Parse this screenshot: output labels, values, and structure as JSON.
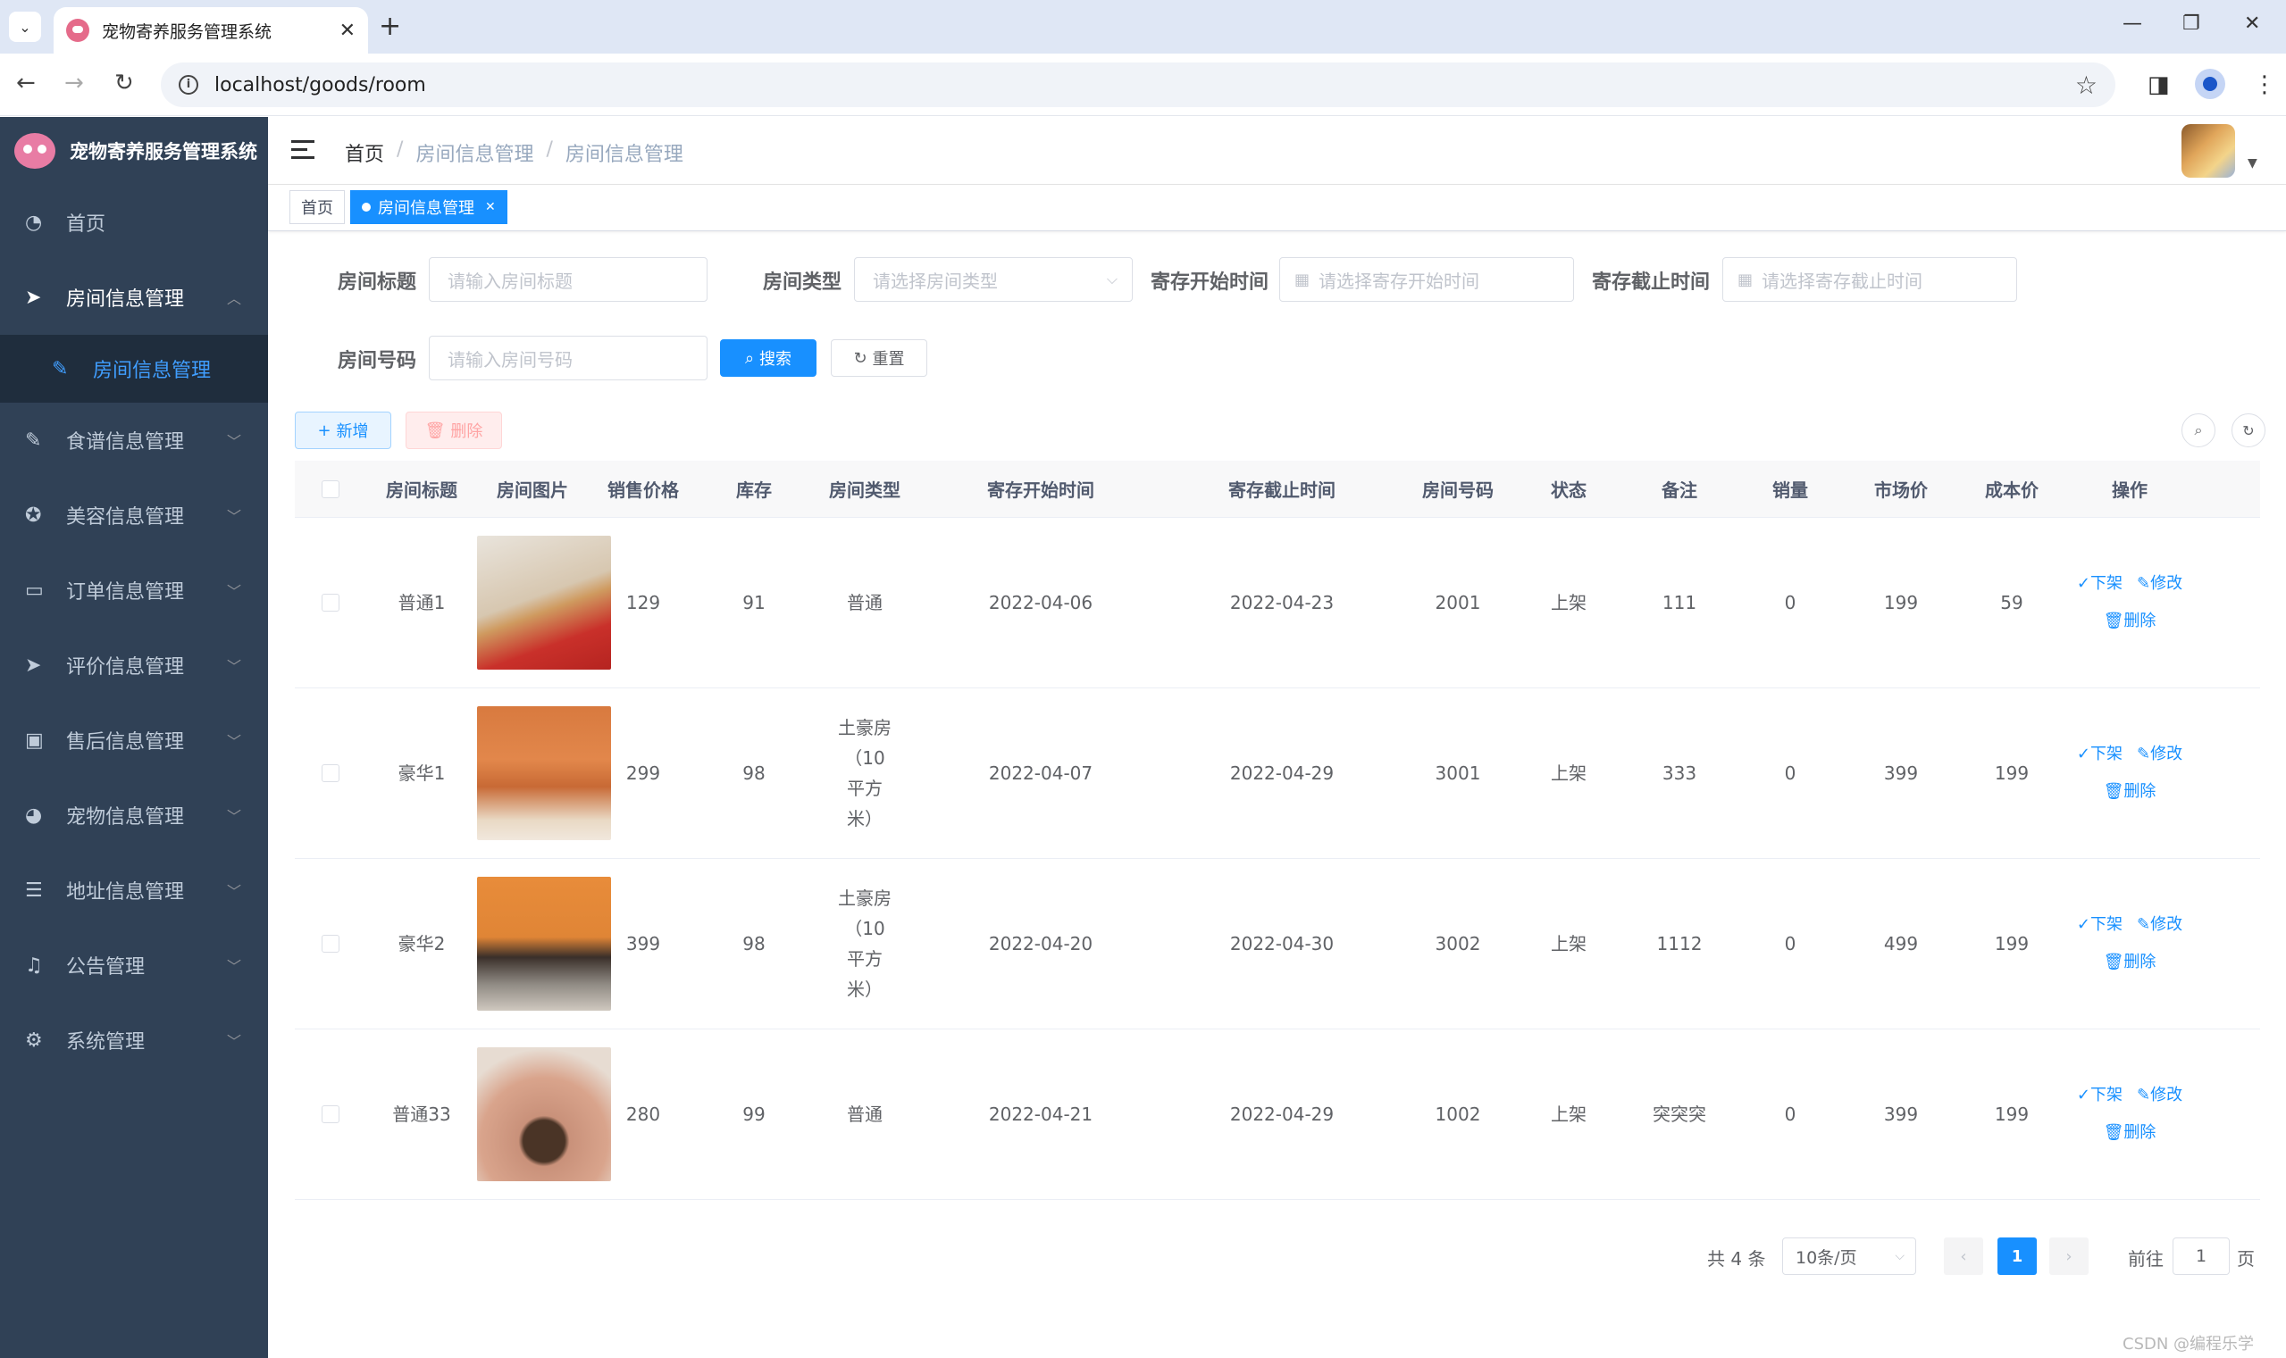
{
  "browser": {
    "tab_title": "宠物寄养服务管理系统",
    "url": "localhost/goods/room"
  },
  "sidebar": {
    "brand": "宠物寄养服务管理系统",
    "items": [
      {
        "label": "首页",
        "icon": "dashboard-icon"
      },
      {
        "label": "房间信息管理",
        "icon": "send-icon"
      },
      {
        "label": "食谱信息管理",
        "icon": "edit-icon"
      },
      {
        "label": "美容信息管理",
        "icon": "component-icon"
      },
      {
        "label": "订单信息管理",
        "icon": "monitor-icon"
      },
      {
        "label": "评价信息管理",
        "icon": "send-icon"
      },
      {
        "label": "售后信息管理",
        "icon": "shopping-icon"
      },
      {
        "label": "宠物信息管理",
        "icon": "globe-icon"
      },
      {
        "label": "地址信息管理",
        "icon": "sliders-icon"
      },
      {
        "label": "公告管理",
        "icon": "bell-icon"
      },
      {
        "label": "系统管理",
        "icon": "gear-icon"
      }
    ],
    "sub_item": "房间信息管理"
  },
  "navbar": {
    "breadcrumb": [
      "首页",
      "房间信息管理",
      "房间信息管理"
    ],
    "separator": "/"
  },
  "tags": {
    "home": "首页",
    "active": "房间信息管理"
  },
  "filters": {
    "title_label": "房间标题",
    "title_placeholder": "请输入房间标题",
    "type_label": "房间类型",
    "type_placeholder": "请选择房间类型",
    "start_label": "寄存开始时间",
    "start_placeholder": "请选择寄存开始时间",
    "end_label": "寄存截止时间",
    "end_placeholder": "请选择寄存截止时间",
    "number_label": "房间号码",
    "number_placeholder": "请输入房间号码",
    "search_btn": "搜索",
    "reset_btn": "重置"
  },
  "toolbar": {
    "add_btn": "新增",
    "delete_btn": "删除"
  },
  "table": {
    "headers": [
      "房间标题",
      "房间图片",
      "销售价格",
      "库存",
      "房间类型",
      "寄存开始时间",
      "寄存截止时间",
      "房间号码",
      "状态",
      "备注",
      "销量",
      "市场价",
      "成本价",
      "操作"
    ],
    "rows": [
      {
        "title": "普通1",
        "price": "129",
        "stock": "91",
        "type": "普通",
        "start": "2022-04-06",
        "end": "2022-04-23",
        "number": "2001",
        "status": "上架",
        "remark": "111",
        "sales": "0",
        "market": "199",
        "cost": "59"
      },
      {
        "title": "豪华1",
        "price": "299",
        "stock": "98",
        "type": "土豪房（10平方米）",
        "start": "2022-04-07",
        "end": "2022-04-29",
        "number": "3001",
        "status": "上架",
        "remark": "333",
        "sales": "0",
        "market": "399",
        "cost": "199"
      },
      {
        "title": "豪华2",
        "price": "399",
        "stock": "98",
        "type": "土豪房（10平方米）",
        "start": "2022-04-20",
        "end": "2022-04-30",
        "number": "3002",
        "status": "上架",
        "remark": "1112",
        "sales": "0",
        "market": "499",
        "cost": "199"
      },
      {
        "title": "普通33",
        "price": "280",
        "stock": "99",
        "type": "普通",
        "start": "2022-04-21",
        "end": "2022-04-29",
        "number": "1002",
        "status": "上架",
        "remark": "突突突",
        "sales": "0",
        "market": "399",
        "cost": "199"
      }
    ],
    "ops": {
      "off": "下架",
      "edit": "修改",
      "delete": "删除"
    }
  },
  "pagination": {
    "total": "共 4 条",
    "page_size": "10条/页",
    "current": "1",
    "goto_label": "前往",
    "goto_value": "1",
    "page_suffix": "页"
  },
  "watermark": "CSDN @编程乐学"
}
